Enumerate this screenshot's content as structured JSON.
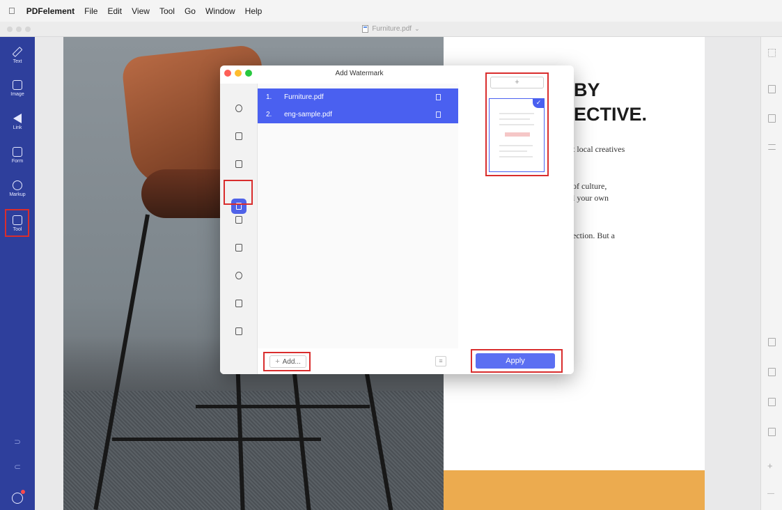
{
  "menubar": {
    "app": "PDFelement",
    "items": [
      "File",
      "Edit",
      "View",
      "Tool",
      "Go",
      "Window",
      "Help"
    ]
  },
  "window": {
    "title": "Furniture.pdf"
  },
  "sidebar": {
    "items": [
      {
        "label": "Text",
        "icon": "pencil-icon"
      },
      {
        "label": "Image",
        "icon": "image-icon"
      },
      {
        "label": "Link",
        "icon": "link-icon"
      },
      {
        "label": "Form",
        "icon": "form-icon"
      },
      {
        "label": "Markup",
        "icon": "markup-icon"
      },
      {
        "label": "Tool",
        "icon": "tool-icon"
      }
    ]
  },
  "document": {
    "headline_1": "BY",
    "headline_2": "ECTIVE.",
    "paragraphs": [
      "t local creatives",
      "of culture,",
      "l your own",
      "ection. But a"
    ]
  },
  "modal": {
    "title": "Add Watermark",
    "files": [
      {
        "num": "1.",
        "name": "Furniture.pdf"
      },
      {
        "num": "2.",
        "name": "eng-sample.pdf"
      }
    ],
    "add_page_label": "+",
    "add_button_label": "Add...",
    "add_button_plus": "+",
    "list_icon_glyph": "≡",
    "apply_label": "Apply",
    "thumbnail_check": "✓"
  },
  "right_panel": {
    "icons": [
      "grid-icon",
      "page-icon",
      "bookmark-icon",
      "list-icon",
      "file-a-icon",
      "file-b-icon",
      "file-c-icon",
      "file-d-icon"
    ],
    "zoom_in_glyph": "+",
    "zoom_out_glyph": "—"
  },
  "colors": {
    "sidebar": "#2e3f9c",
    "accent": "#4a60f0",
    "highlight": "#d92d2d",
    "orange_band": "#ecab4f"
  }
}
